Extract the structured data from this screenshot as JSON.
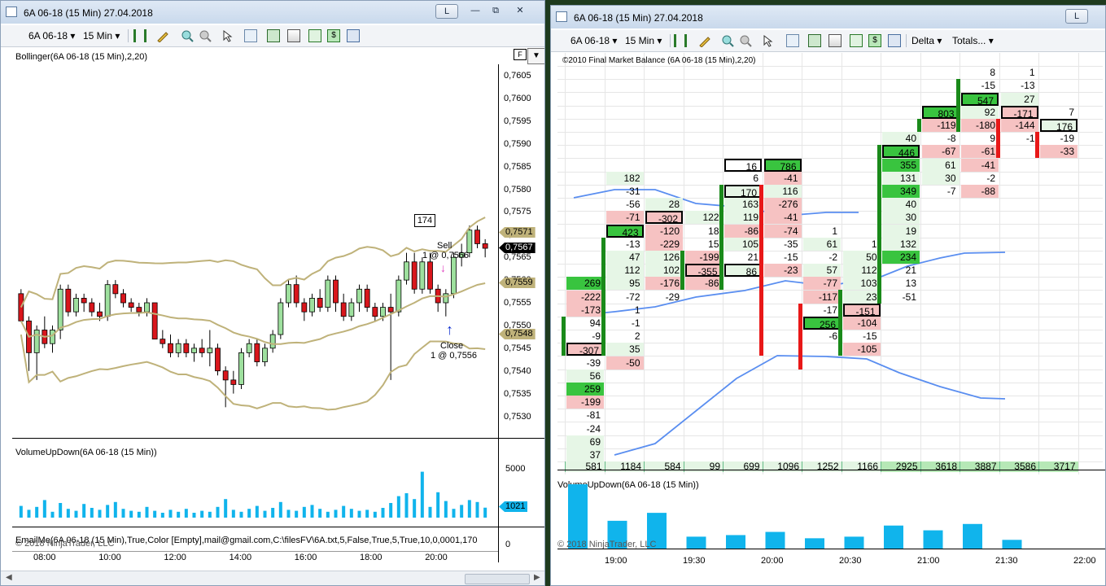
{
  "left_window": {
    "title": "6A 06-18 (15 Min)  27.04.2018",
    "buttons": {
      "min": "L",
      "restore": "⧉",
      "close": "✕"
    },
    "toolbar": {
      "instrument": "6A 06-18",
      "interval": "15 Min"
    },
    "price_panel_label": "Bollinger(6A 06-18 (15 Min),2,20)",
    "volume_panel_label": "VolumeUpDown(6A 06-18 (15 Min))",
    "bottom_overlay_text": "EmailMe(6A 06-18 (15 Min),True,Color [Empty],mail@gmail.com,C:\\filesFV\\6A.txt,5,False,True,5,True,10,0,0001,170",
    "copyright": "© 2018 NinjaTrader, LLC",
    "y_ticks": [
      "0,7605",
      "0,7600",
      "0,7595",
      "0,7590",
      "0,7585",
      "0,7580",
      "0,7575",
      "0,7570",
      "0,7565",
      "0,7560",
      "0,7555",
      "0,7550",
      "0,7545",
      "0,7540",
      "0,7535",
      "0,7530"
    ],
    "price_tags": {
      "upper": "0,7571",
      "last": "0,7567",
      "mid": "0,7559",
      "lower": "0,7548"
    },
    "volume_ticks": {
      "top": "5000",
      "bottom": "0",
      "current": "1021"
    },
    "x_ticks": [
      "08:00",
      "10:00",
      "12:00",
      "14:00",
      "16:00",
      "18:00",
      "20:00"
    ],
    "annotations": {
      "box": "174",
      "sell": "Sell",
      "sell_detail": "1 @ 0,7566",
      "close": "Close",
      "close_detail": "1 @ 0,7556",
      "f_button": "F"
    }
  },
  "right_window": {
    "title": "6A 06-18 (15 Min)  27.04.2018",
    "buttons": {
      "min": "L"
    },
    "toolbar": {
      "instrument": "6A 06-18",
      "interval": "15 Min",
      "delta": "Delta",
      "totals": "Totals..."
    },
    "indicator_label": "©2010 Final Market Balance  (6A 06-18 (15 Min),2,20)",
    "volume_panel_label": "VolumeUpDown(6A 06-18 (15 Min))",
    "copyright": "© 2018 NinjaTrader, LLC",
    "x_ticks": [
      "19:00",
      "19:30",
      "20:00",
      "20:30",
      "21:00",
      "21:30",
      "22:00"
    ],
    "totals": [
      "581",
      "1184",
      "584",
      "99",
      "699",
      "1096",
      "1252",
      "1166",
      "2925",
      "3618",
      "3887",
      "3586",
      "3717"
    ]
  },
  "colors": {
    "up_candle": "#9ee09e",
    "down_candle": "#d9161c",
    "bollinger": "#bfb27a",
    "volume_bar": "#10b4ec",
    "delta_pos": "#39c43f",
    "delta_neg": "#f6c2c2",
    "fmb_line": "#5a8ef0"
  },
  "footprint_columns": [
    {
      "cells": [
        [
          "269",
          "pos",
          0
        ],
        [
          "-222",
          "neg",
          0
        ],
        [
          "-173",
          "neg",
          0
        ],
        [
          "94",
          "none",
          0
        ],
        [
          "-9",
          "none",
          0
        ],
        [
          "-307",
          "neg",
          1
        ],
        [
          "-39",
          "none",
          0
        ],
        [
          "56",
          "lpos",
          0
        ],
        [
          "259",
          "pos",
          0
        ],
        [
          "-199",
          "neg",
          0
        ],
        [
          "-81",
          "none",
          0
        ],
        [
          "-24",
          "none",
          0
        ],
        [
          "69",
          "lpos",
          0
        ],
        [
          "37",
          "lpos",
          0
        ]
      ]
    },
    {
      "cells": [
        [
          "182",
          "lpos",
          0
        ],
        [
          "-31",
          "none",
          0
        ],
        [
          "-56",
          "none",
          0
        ],
        [
          "-71",
          "neg",
          0
        ],
        [
          "423",
          "pos",
          1
        ],
        [
          "-13",
          "none",
          0
        ],
        [
          "47",
          "lpos",
          0
        ],
        [
          "112",
          "lpos",
          0
        ],
        [
          "95",
          "lpos",
          0
        ],
        [
          "-72",
          "none",
          0
        ],
        [
          "1",
          "none",
          0
        ],
        [
          "-1",
          "none",
          0
        ],
        [
          "2",
          "none",
          0
        ],
        [
          "35",
          "lpos",
          0
        ],
        [
          "-50",
          "neg",
          0
        ]
      ]
    },
    {
      "cells": [
        [
          "28",
          "lpos",
          0
        ],
        [
          "-302",
          "neg",
          1
        ],
        [
          "-120",
          "neg",
          0
        ],
        [
          "-229",
          "neg",
          0
        ],
        [
          "126",
          "lpos",
          0
        ],
        [
          "102",
          "lpos",
          0
        ],
        [
          "-176",
          "neg",
          0
        ],
        [
          "-29",
          "none",
          0
        ]
      ]
    },
    {
      "cells": [
        [
          "122",
          "lpos",
          0
        ],
        [
          "18",
          "none",
          0
        ],
        [
          "15",
          "none",
          0
        ],
        [
          "-199",
          "neg",
          0
        ],
        [
          "-355",
          "neg",
          1
        ],
        [
          "-86",
          "neg",
          0
        ]
      ]
    },
    {
      "cells": [
        [
          "16",
          "none",
          1
        ],
        [
          "6",
          "none",
          0
        ],
        [
          "170",
          "lpos",
          1
        ],
        [
          "163",
          "lpos",
          0
        ],
        [
          "119",
          "lpos",
          0
        ],
        [
          "-86",
          "neg",
          0
        ],
        [
          "105",
          "lpos",
          0
        ],
        [
          "21",
          "none",
          0
        ],
        [
          "86",
          "lpos",
          1
        ]
      ]
    },
    {
      "cells": [
        [
          "786",
          "pos",
          1
        ],
        [
          "-41",
          "neg",
          0
        ],
        [
          "116",
          "lpos",
          0
        ],
        [
          "-276",
          "neg",
          0
        ],
        [
          "-41",
          "neg",
          0
        ],
        [
          "-74",
          "neg",
          0
        ],
        [
          "-35",
          "none",
          0
        ],
        [
          "-15",
          "none",
          0
        ],
        [
          "-23",
          "neg",
          0
        ]
      ]
    },
    {
      "cells": [
        [
          "1",
          "none",
          0
        ],
        [
          "61",
          "lpos",
          0
        ],
        [
          "-2",
          "none",
          0
        ],
        [
          "57",
          "lpos",
          0
        ],
        [
          "-77",
          "neg",
          0
        ],
        [
          "-117",
          "neg",
          0
        ],
        [
          "-17",
          "none",
          0
        ],
        [
          "256",
          "pos",
          1
        ],
        [
          "-6",
          "none",
          0
        ]
      ]
    },
    {
      "cells": [
        [
          "1",
          "none",
          0
        ],
        [
          "50",
          "lpos",
          0
        ],
        [
          "112",
          "lpos",
          0
        ],
        [
          "103",
          "lpos",
          0
        ],
        [
          "23",
          "lpos",
          0
        ],
        [
          "-151",
          "neg",
          1
        ],
        [
          "-104",
          "neg",
          0
        ],
        [
          "-15",
          "none",
          0
        ],
        [
          "-105",
          "neg",
          0
        ]
      ]
    },
    {
      "cells": [
        [
          "40",
          "lpos",
          0
        ],
        [
          "446",
          "pos",
          1
        ],
        [
          "355",
          "pos",
          0
        ],
        [
          "131",
          "lpos",
          0
        ],
        [
          "349",
          "pos",
          0
        ],
        [
          "40",
          "lpos",
          0
        ],
        [
          "30",
          "lpos",
          0
        ],
        [
          "19",
          "lpos",
          0
        ],
        [
          "132",
          "lpos",
          0
        ],
        [
          "234",
          "pos",
          0
        ],
        [
          "21",
          "none",
          0
        ],
        [
          "13",
          "none",
          0
        ],
        [
          "-51",
          "none",
          0
        ]
      ]
    },
    {
      "cells": [
        [
          "803",
          "pos",
          1
        ],
        [
          "-119",
          "neg",
          0
        ],
        [
          "-8",
          "none",
          0
        ],
        [
          "-67",
          "neg",
          0
        ],
        [
          "61",
          "lpos",
          0
        ],
        [
          "30",
          "lpos",
          0
        ],
        [
          "-7",
          "none",
          0
        ]
      ]
    },
    {
      "cells": [
        [
          "8",
          "none",
          0
        ],
        [
          "-15",
          "none",
          0
        ],
        [
          "547",
          "pos",
          1
        ],
        [
          "92",
          "lpos",
          0
        ],
        [
          "-180",
          "neg",
          0
        ],
        [
          "9",
          "none",
          0
        ],
        [
          "-61",
          "neg",
          0
        ],
        [
          "-41",
          "neg",
          0
        ],
        [
          "-2",
          "none",
          0
        ],
        [
          "-88",
          "neg",
          0
        ]
      ]
    },
    {
      "cells": [
        [
          "1",
          "none",
          0
        ],
        [
          "-13",
          "none",
          0
        ],
        [
          "27",
          "lpos",
          0
        ],
        [
          "-171",
          "neg",
          1
        ],
        [
          "-144",
          "neg",
          0
        ],
        [
          "-1",
          "none",
          0
        ]
      ]
    },
    {
      "cells": [
        [
          "7",
          "none",
          0
        ],
        [
          "176",
          "lpos",
          1
        ],
        [
          "-19",
          "none",
          0
        ],
        [
          "-33",
          "neg",
          0
        ]
      ]
    }
  ],
  "candles": [
    [
      0.7557,
      0.7558,
      0.7551,
      0.7551
    ],
    [
      0.7551,
      0.7552,
      0.754,
      0.7544
    ],
    [
      0.7544,
      0.755,
      0.7538,
      0.7549
    ],
    [
      0.7549,
      0.7552,
      0.7545,
      0.7546
    ],
    [
      0.7546,
      0.755,
      0.7544,
      0.7549
    ],
    [
      0.7549,
      0.7559,
      0.7547,
      0.7558
    ],
    [
      0.7558,
      0.7559,
      0.7552,
      0.7553
    ],
    [
      0.7553,
      0.7557,
      0.7552,
      0.7556
    ],
    [
      0.7556,
      0.7557,
      0.7553,
      0.7555
    ],
    [
      0.7555,
      0.7556,
      0.7552,
      0.7553
    ],
    [
      0.7553,
      0.7555,
      0.7551,
      0.7552
    ],
    [
      0.7552,
      0.756,
      0.7551,
      0.7559
    ],
    [
      0.7559,
      0.756,
      0.7556,
      0.7557
    ],
    [
      0.7557,
      0.7558,
      0.7554,
      0.7555
    ],
    [
      0.7555,
      0.7556,
      0.7553,
      0.7554
    ],
    [
      0.7554,
      0.7555,
      0.7552,
      0.7553
    ],
    [
      0.7553,
      0.7556,
      0.7552,
      0.7555
    ],
    [
      0.7555,
      0.7555,
      0.7548,
      0.7547
    ],
    [
      0.7547,
      0.7549,
      0.7545,
      0.7546
    ],
    [
      0.7546,
      0.7548,
      0.7543,
      0.7544
    ],
    [
      0.7544,
      0.7547,
      0.7543,
      0.7546
    ],
    [
      0.7546,
      0.7547,
      0.7543,
      0.7544
    ],
    [
      0.7544,
      0.7546,
      0.7542,
      0.7545
    ],
    [
      0.7545,
      0.7547,
      0.7543,
      0.7544
    ],
    [
      0.7544,
      0.7549,
      0.7541,
      0.7545
    ],
    [
      0.7545,
      0.7546,
      0.7539,
      0.754
    ],
    [
      0.754,
      0.7541,
      0.7532,
      0.7538
    ],
    [
      0.7538,
      0.754,
      0.7535,
      0.7537
    ],
    [
      0.7537,
      0.7545,
      0.7536,
      0.7544
    ],
    [
      0.7544,
      0.7547,
      0.7543,
      0.7546
    ],
    [
      0.7546,
      0.7547,
      0.7541,
      0.7542
    ],
    [
      0.7542,
      0.7546,
      0.7541,
      0.7545
    ],
    [
      0.7545,
      0.7549,
      0.7544,
      0.7548
    ],
    [
      0.7548,
      0.7556,
      0.7547,
      0.7555
    ],
    [
      0.7555,
      0.756,
      0.7554,
      0.7559
    ],
    [
      0.7559,
      0.7561,
      0.7554,
      0.7555
    ],
    [
      0.7555,
      0.7556,
      0.7551,
      0.7553
    ],
    [
      0.7553,
      0.7557,
      0.7552,
      0.7556
    ],
    [
      0.7556,
      0.7558,
      0.7553,
      0.7554
    ],
    [
      0.7554,
      0.7561,
      0.7553,
      0.756
    ],
    [
      0.756,
      0.7561,
      0.7553,
      0.7555
    ],
    [
      0.7555,
      0.7557,
      0.7551,
      0.7552
    ],
    [
      0.7552,
      0.7556,
      0.7551,
      0.7555
    ],
    [
      0.7555,
      0.7559,
      0.7553,
      0.7558
    ],
    [
      0.7558,
      0.7559,
      0.7553,
      0.7554
    ],
    [
      0.7554,
      0.7555,
      0.7551,
      0.7552
    ],
    [
      0.7552,
      0.7555,
      0.7551,
      0.7554
    ],
    [
      0.7554,
      0.7557,
      0.7538,
      0.7553
    ],
    [
      0.7553,
      0.7561,
      0.7552,
      0.756
    ],
    [
      0.756,
      0.7566,
      0.7559,
      0.7564
    ],
    [
      0.7564,
      0.7566,
      0.7557,
      0.7558
    ],
    [
      0.7558,
      0.7565,
      0.7557,
      0.7564
    ],
    [
      0.7564,
      0.7566,
      0.7557,
      0.7558
    ],
    [
      0.7558,
      0.7559,
      0.7553,
      0.7555
    ],
    [
      0.7555,
      0.7558,
      0.7552,
      0.7557
    ],
    [
      0.7557,
      0.7566,
      0.7556,
      0.7565
    ],
    [
      0.7565,
      0.7568,
      0.7563,
      0.7566
    ],
    [
      0.7566,
      0.7572,
      0.7565,
      0.7571
    ],
    [
      0.7571,
      0.7572,
      0.7567,
      0.7568
    ],
    [
      0.7568,
      0.7569,
      0.7565,
      0.7567
    ]
  ],
  "volumes_left": [
    1200,
    800,
    1100,
    1800,
    600,
    1500,
    900,
    700,
    1400,
    1000,
    800,
    1300,
    1600,
    900,
    700,
    600,
    1100,
    700,
    500,
    800,
    600,
    900,
    500,
    700,
    600,
    1100,
    1900,
    800,
    600,
    900,
    1200,
    700,
    1000,
    1600,
    800,
    700,
    1100,
    1300,
    900,
    600,
    800,
    1200,
    900,
    700,
    800,
    600,
    1000,
    1500,
    2200,
    2500,
    1900,
    4700,
    1100,
    2600,
    1700,
    900,
    1300,
    1800,
    1600,
    1021
  ],
  "volumes_right": [
    4100,
    1800,
    2300,
    800,
    900,
    1100,
    700,
    800,
    1500,
    1200,
    1600,
    600,
    0
  ]
}
